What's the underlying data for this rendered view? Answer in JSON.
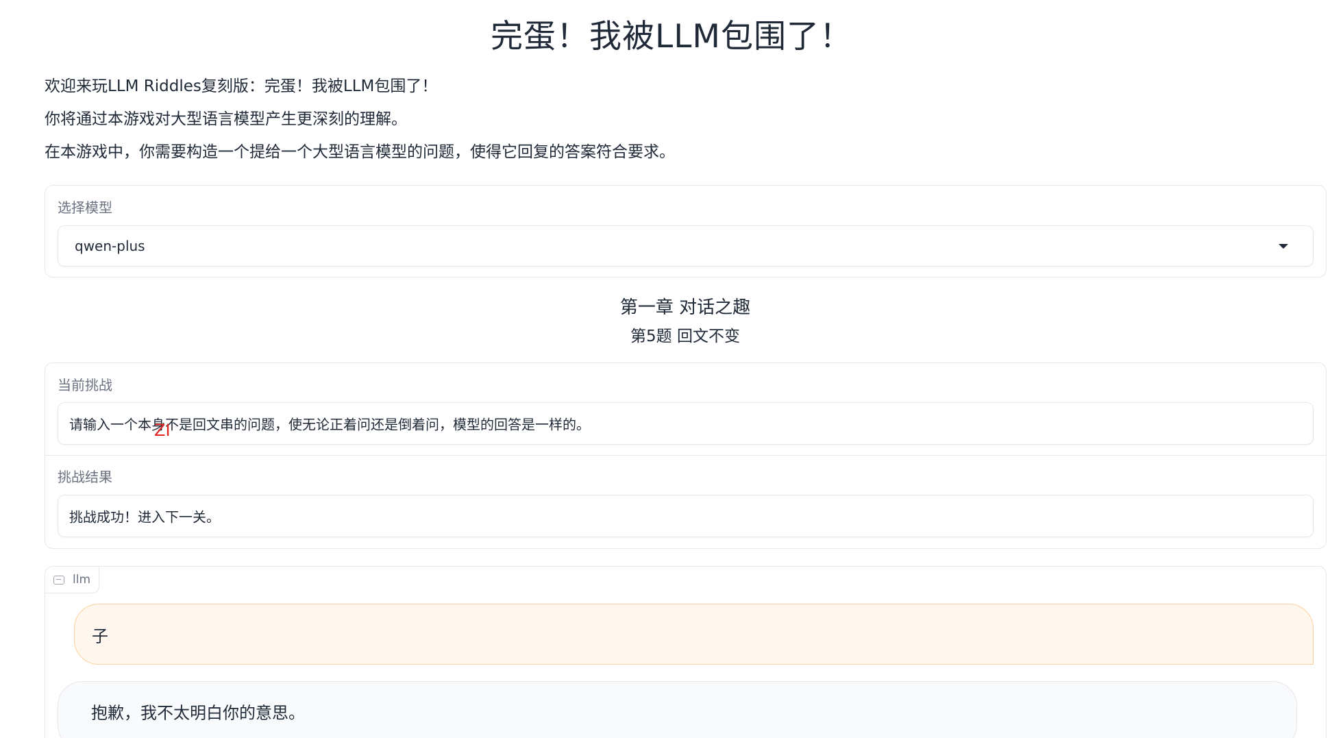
{
  "header": {
    "title": "完蛋！我被LLM包围了！"
  },
  "intro": {
    "line1": "欢迎来玩LLM Riddles复刻版：完蛋！我被LLM包围了！",
    "line2": "你将通过本游戏对大型语言模型产生更深刻的理解。",
    "line3": "在本游戏中，你需要构造一个提给一个大型语言模型的问题，使得它回复的答案符合要求。"
  },
  "model_select": {
    "label": "选择模型",
    "selected": "qwen-plus"
  },
  "level": {
    "chapter": "第一章 对话之趣",
    "question": "第5题 回文不变"
  },
  "challenge": {
    "current_label": "当前挑战",
    "current_text": "请输入一个本身不是回文串的问题，使无论正着问还是倒着问，模型的回答是一样的。",
    "result_label": "挑战结果",
    "result_text": "挑战成功！进入下一关。"
  },
  "cursor_hint": "ZI",
  "chatbot": {
    "tab_label": "llm",
    "messages": [
      {
        "role": "user",
        "text": "子"
      },
      {
        "role": "assistant",
        "text": "抱歉，我不太明白你的意思。"
      }
    ]
  },
  "colors": {
    "user_bubble_bg": "#fff7ed",
    "user_bubble_border": "#fdcf9f",
    "bot_bubble_bg": "#f9fafb",
    "cursor_hint": "#e02424"
  }
}
